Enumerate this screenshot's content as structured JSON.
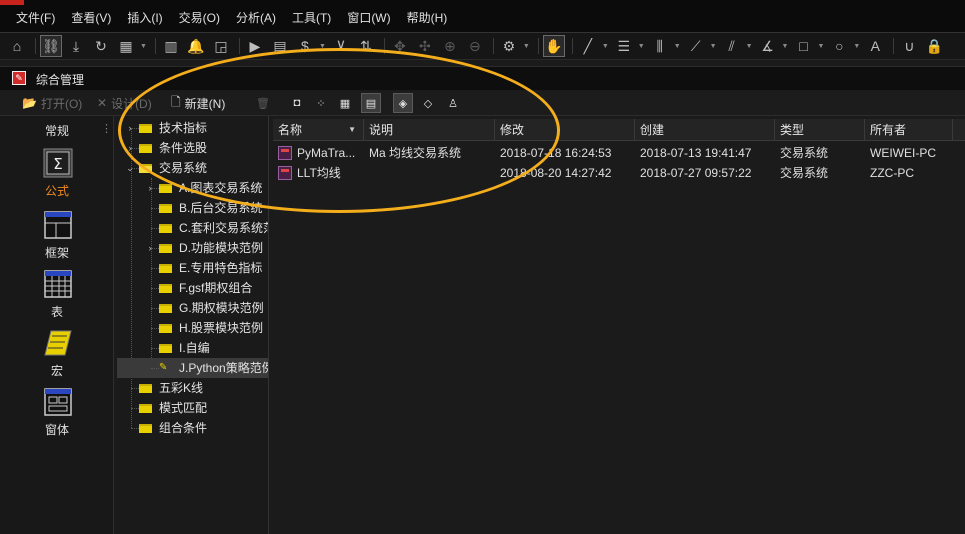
{
  "menu": [
    "文件(F)",
    "查看(V)",
    "插入(I)",
    "交易(O)",
    "分析(A)",
    "工具(T)",
    "窗口(W)",
    "帮助(H)"
  ],
  "toolbar_icons": [
    "home-icon",
    "link-icon",
    "download-icon",
    "refresh-icon",
    "grid-icon",
    "bar-chart-icon",
    "bell-icon",
    "chart-icon",
    "play-icon",
    "document-icon",
    "dollar-icon",
    "filter-icon",
    "sort-icon",
    "move-icon",
    "crosshair-icon",
    "zoom-in-icon",
    "zoom-out-icon",
    "gear-icon",
    "hand-icon",
    "line-icon",
    "fibonacci-icon",
    "vertical-lines-icon",
    "fan-icon",
    "parallel-icon",
    "angle-icon",
    "rectangle-icon",
    "circle-icon",
    "text-icon",
    "magnet-icon",
    "lock-icon"
  ],
  "window": {
    "title": "综合管理"
  },
  "subtoolbar": {
    "open": "打开(O)",
    "design": "设计(D)",
    "new": "新建(N)"
  },
  "leftnav": {
    "title": "常规",
    "items": [
      {
        "label": "公式",
        "icon": "formula-icon",
        "active": true
      },
      {
        "label": "框架",
        "icon": "frame-icon",
        "active": false
      },
      {
        "label": "表",
        "icon": "table-icon",
        "active": false
      },
      {
        "label": "宏",
        "icon": "macro-icon",
        "active": false
      },
      {
        "label": "窗体",
        "icon": "form-icon",
        "active": false
      }
    ]
  },
  "tree": [
    {
      "label": "技术指标"
    },
    {
      "label": "条件选股"
    },
    {
      "label": "交易系统"
    },
    {
      "label": "A.图表交易系统"
    },
    {
      "label": "B.后台交易系统"
    },
    {
      "label": "C.套利交易系统范"
    },
    {
      "label": "D.功能模块范例"
    },
    {
      "label": "E.专用特色指标"
    },
    {
      "label": "F.gsf期权组合"
    },
    {
      "label": "G.期权模块范例"
    },
    {
      "label": "H.股票模块范例"
    },
    {
      "label": "I.自编"
    },
    {
      "label": "J.Python策略范例"
    },
    {
      "label": "五彩K线"
    },
    {
      "label": "模式匹配"
    },
    {
      "label": "组合条件"
    }
  ],
  "columns": [
    "名称",
    "说明",
    "修改",
    "创建",
    "类型",
    "所有者"
  ],
  "rows": [
    [
      "PyMaTra...",
      "Ma 均线交易系统",
      "2018-07-18 16:24:53",
      "2018-07-13 19:41:47",
      "交易系统",
      "WEIWEI-PC"
    ],
    [
      "LLT均线",
      "",
      "2018-08-20 14:27:42",
      "2018-07-27 09:57:22",
      "交易系统",
      "ZZC-PC"
    ]
  ],
  "colors": {
    "accent": "#f4ae1c",
    "active_nav": "#f08a24",
    "folder": "#e8d000"
  }
}
